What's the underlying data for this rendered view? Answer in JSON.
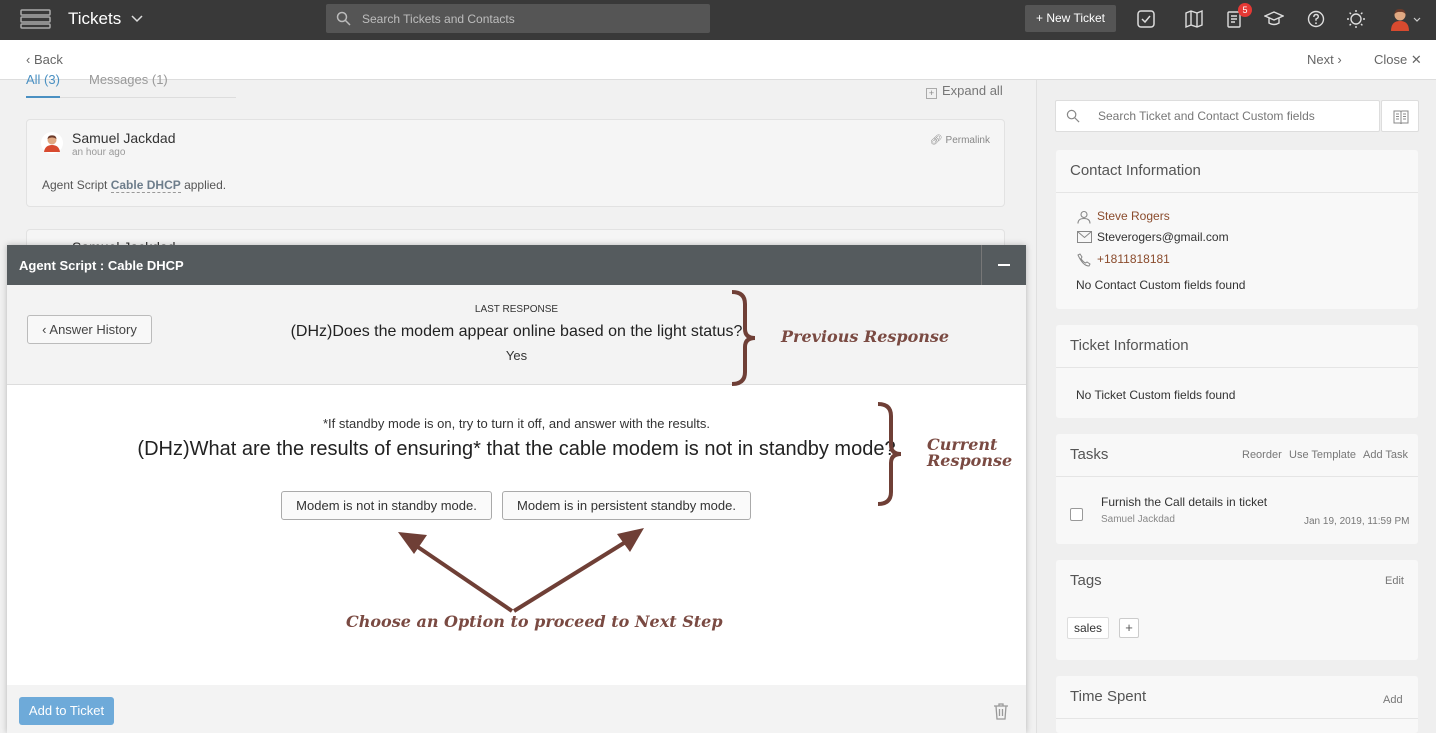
{
  "topbar": {
    "title": "Tickets",
    "search_placeholder": "Search Tickets and Contacts",
    "new_ticket_label": "+ New Ticket",
    "notification_count": "5"
  },
  "subbar": {
    "back_label": "Back",
    "next_label": "Next",
    "close_label": "Close"
  },
  "conversation": {
    "tabs": [
      {
        "label": "All (3)",
        "active": true
      },
      {
        "label": "Messages (1)",
        "active": false
      }
    ],
    "expand_all_label": "Expand all",
    "entries": [
      {
        "author": "Samuel Jackdad",
        "time": "an hour ago",
        "permalink_label": "Permalink",
        "body_prefix": "Agent Script",
        "script_name": "Cable DHCP",
        "body_suffix": "applied."
      },
      {
        "author": "Samuel Jackdad"
      }
    ]
  },
  "agent_script": {
    "title": "Agent Script : Cable DHCP",
    "answer_history_label": "Answer History",
    "last_response": {
      "label": "LAST RESPONSE",
      "question": "(DHz)Does the modem appear online based on the light status?",
      "answer": "Yes"
    },
    "current": {
      "note": "*If standby mode is on, try to turn it off, and answer with the results.",
      "question": "(DHz)What are the results of ensuring* that the cable modem is not in standby mode?",
      "options": [
        "Modem is not in standby mode.",
        "Modem is in persistent standby mode."
      ]
    },
    "add_to_ticket_label": "Add to Ticket",
    "annotations": {
      "previous": "Previous Response",
      "current_line1": "Current",
      "current_line2": "Response",
      "choose": "Choose an Option to proceed to Next Step"
    }
  },
  "sidebar": {
    "custom_field_search_placeholder": "Search Ticket and Contact Custom fields",
    "contact": {
      "title": "Contact Information",
      "name": "Steve Rogers",
      "email": "Steverogers@gmail.com",
      "phone": "+1811818181",
      "empty_note": "No Contact Custom fields found"
    },
    "ticket_info": {
      "title": "Ticket Information",
      "empty_note": "No Ticket Custom fields found"
    },
    "tasks": {
      "title": "Tasks",
      "actions": [
        "Reorder",
        "Use Template",
        "Add Task"
      ],
      "items": [
        {
          "title": "Furnish the Call details in ticket",
          "assignee": "Samuel Jackdad",
          "date": "Jan 19, 2019, 11:59 PM"
        }
      ]
    },
    "tags": {
      "title": "Tags",
      "edit_label": "Edit",
      "items": [
        "sales"
      ],
      "add_label": "+"
    },
    "time_spent": {
      "title": "Time Spent",
      "add_label": "Add"
    }
  },
  "colors": {
    "accent": "#4a90c2",
    "header": "#393939",
    "annotation": "#7a4a42",
    "link": "#8a4b2c",
    "primary_button": "#6eaad9"
  },
  "icons": [
    "menu-logo-icon",
    "search-icon",
    "checkbox-icon",
    "book-icon",
    "notifications-icon",
    "graduation-cap-icon",
    "help-icon",
    "bulb-icon",
    "user-icon",
    "mail-icon",
    "phone-icon",
    "trash-icon",
    "link-icon"
  ]
}
